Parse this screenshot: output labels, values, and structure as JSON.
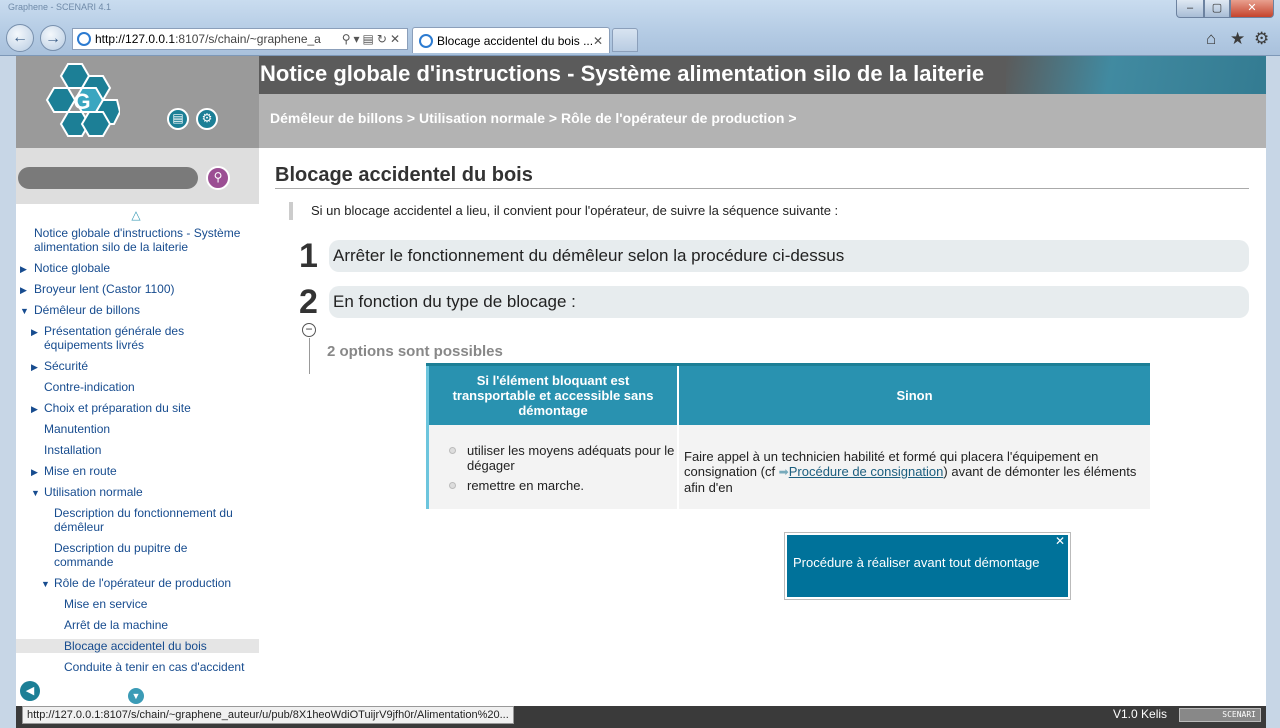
{
  "browser": {
    "window_title": "Graphene - SCENARI 4.1",
    "url_host": "http://127.0.0.1",
    "url_rest": ":8107/s/chain/~graphene_a",
    "tab_title": "Blocage accidentel du bois ...",
    "status_url": "http://127.0.0.1:8107/s/chain/~graphene_auteur/u/pub/8X1heoWdiOTuijrV9jfh0r/Alimentation%20..."
  },
  "header": {
    "title": "Notice globale d'instructions - Système alimentation silo de la laiterie",
    "breadcrumb": "Démêleur de billons > Utilisation normale > Rôle de l'opérateur de production >"
  },
  "toc": {
    "items": [
      {
        "label": "Notice globale d'instructions - Système alimentation silo de la laiterie",
        "level": 0,
        "arrow": ""
      },
      {
        "label": "Notice globale",
        "level": 0,
        "arrow": "▶"
      },
      {
        "label": "Broyeur lent (Castor 1100)",
        "level": 0,
        "arrow": "▶"
      },
      {
        "label": "Démêleur de billons",
        "level": 0,
        "arrow": "▼"
      },
      {
        "label": "Présentation générale des équipements livrés",
        "level": 1,
        "arrow": "▶"
      },
      {
        "label": "Sécurité",
        "level": 1,
        "arrow": "▶"
      },
      {
        "label": "Contre-indication",
        "level": 1,
        "arrow": ""
      },
      {
        "label": "Choix et préparation du site",
        "level": 1,
        "arrow": "▶"
      },
      {
        "label": "Manutention",
        "level": 1,
        "arrow": ""
      },
      {
        "label": "Installation",
        "level": 1,
        "arrow": ""
      },
      {
        "label": "Mise en route",
        "level": 1,
        "arrow": "▶"
      },
      {
        "label": "Utilisation normale",
        "level": 1,
        "arrow": "▼"
      },
      {
        "label": "Description du fonctionnement du démêleur",
        "level": 2,
        "arrow": ""
      },
      {
        "label": "Description du pupitre de commande",
        "level": 2,
        "arrow": ""
      },
      {
        "label": "Rôle de l'opérateur de production",
        "level": 2,
        "arrow": "▼"
      },
      {
        "label": "Mise en service",
        "level": 3,
        "arrow": ""
      },
      {
        "label": "Arrêt de la machine",
        "level": 3,
        "arrow": ""
      },
      {
        "label": "Blocage accidentel du bois",
        "level": 3,
        "arrow": "",
        "selected": true
      },
      {
        "label": "Conduite à tenir en cas d'accident",
        "level": 3,
        "arrow": ""
      }
    ]
  },
  "content": {
    "title": "Blocage accidentel du bois",
    "intro": "Si un blocage accidentel a lieu, il convient pour l'opérateur, de suivre la séquence suivante :",
    "steps": [
      {
        "num": "1",
        "text": "Arrêter le fonctionnement du démêleur selon la procédure ci-dessus"
      },
      {
        "num": "2",
        "text": "En fonction du type de blocage :"
      }
    ],
    "options_label": "2 options sont possibles",
    "table": {
      "col1_header": "Si l'élément bloquant est transportable et accessible sans démontage",
      "col2_header": "Sinon",
      "col1_items": [
        "utiliser les moyens adéquats pour le dégager",
        "remettre en marche."
      ],
      "col2_text_before": "Faire appel à un technicien habilité et formé qui placera l'équipement en consignation (cf ",
      "col2_link": "Procédure de consignation",
      "col2_text_after": ") avant de démonter les éléments afin d'en"
    },
    "tooltip": "Procédure à réaliser avant tout démontage"
  },
  "footer": {
    "version": "V1.0  Kelis",
    "scenari": "SCENARI"
  },
  "colors": {
    "accent": "#2992b0",
    "header_dark": "#5b5b5b",
    "breadcrumb_bg": "#b3b3b3",
    "link": "#174c8f"
  }
}
